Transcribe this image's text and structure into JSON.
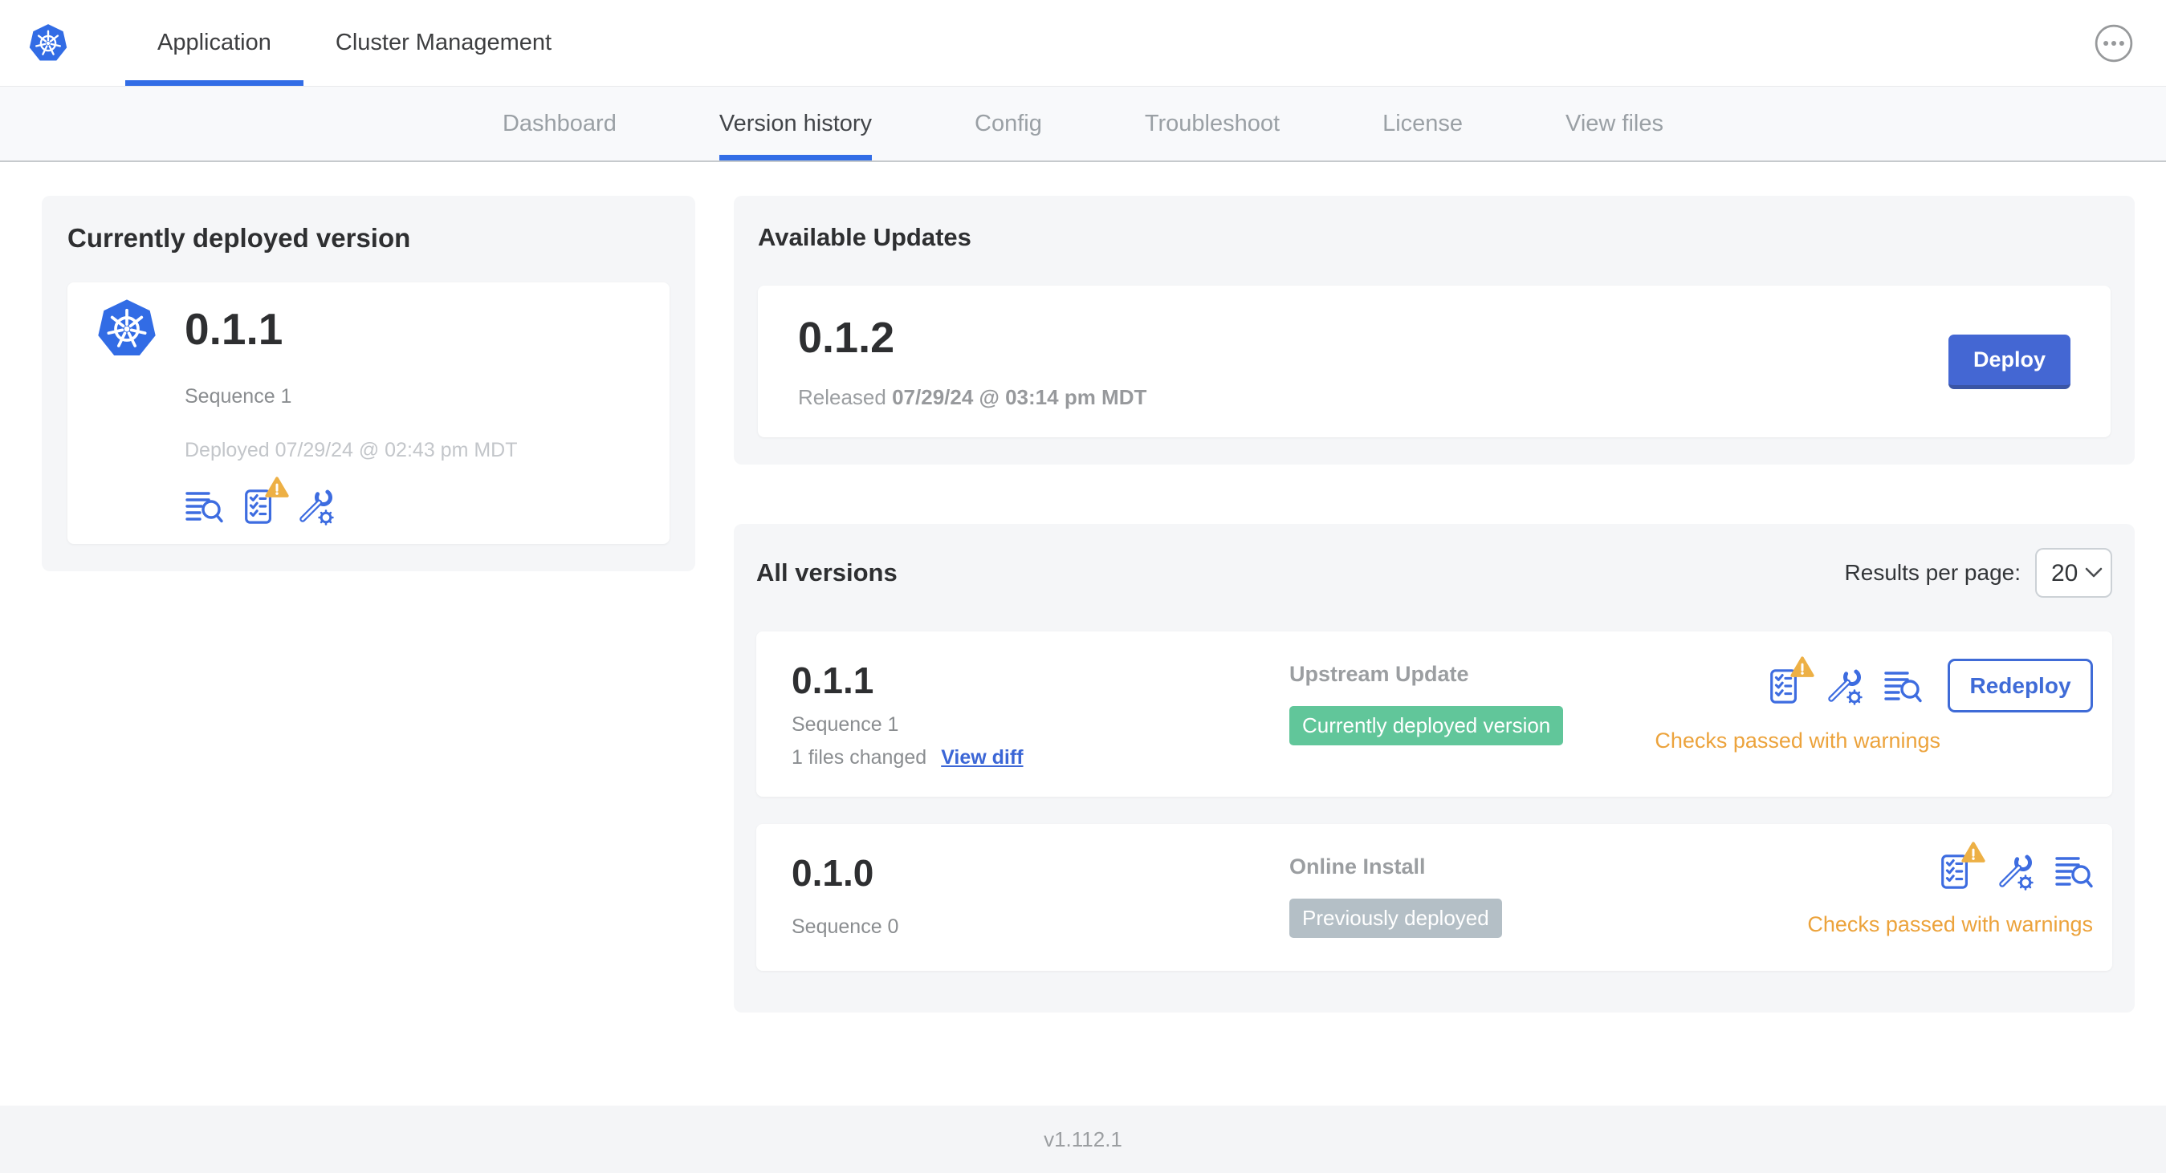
{
  "colors": {
    "brand_blue": "#326ce5",
    "accent_blue": "#3d6ce0",
    "deploy_button_blue": "#4467d3",
    "active_underline_blue": "#326de6",
    "success_green": "#61c69a",
    "muted_badge_gray": "#b4bfc6",
    "warning_orange": "#eca33c",
    "card_background": "#f5f6f8",
    "text_dark": "#323232",
    "text_gray": "#9b9ea1"
  },
  "header": {
    "logo_icon": "kubernetes-logo",
    "overflow_icon": "ellipsis-menu-icon",
    "tabs": [
      {
        "label": "Application",
        "active": true
      },
      {
        "label": "Cluster Management",
        "active": false
      }
    ]
  },
  "subnav": {
    "tabs": [
      {
        "label": "Dashboard",
        "active": false
      },
      {
        "label": "Version history",
        "active": true
      },
      {
        "label": "Config",
        "active": false
      },
      {
        "label": "Troubleshoot",
        "active": false
      },
      {
        "label": "License",
        "active": false
      },
      {
        "label": "View files",
        "active": false
      }
    ]
  },
  "current_version": {
    "title": "Currently deployed version",
    "version": "0.1.1",
    "sequence": "Sequence 1",
    "deployed": "Deployed 07/29/24 @ 02:43 pm MDT",
    "icons": [
      "logs-search-icon",
      "preflight-checks-warning-icon",
      "config-wrench-icon"
    ]
  },
  "available_updates": {
    "title": "Available Updates",
    "version": "0.1.2",
    "released_label": "Released",
    "released_date": "07/29/24 @ 03:14 pm MDT",
    "deploy_label": "Deploy"
  },
  "all_versions": {
    "title": "All versions",
    "results_per_page_label": "Results per page:",
    "results_per_page_value": "20",
    "rows": [
      {
        "version": "0.1.1",
        "sequence": "Sequence 1",
        "files_changed": "1 files changed",
        "view_diff_label": "View diff",
        "source": "Upstream Update",
        "badge_label": "Currently deployed version",
        "badge_type": "green",
        "status": "Checks passed with warnings",
        "action_label": "Redeploy",
        "icons": [
          "preflight-checks-warning-icon",
          "config-wrench-icon",
          "logs-search-icon"
        ]
      },
      {
        "version": "0.1.0",
        "sequence": "Sequence 0",
        "source": "Online Install",
        "badge_label": "Previously deployed",
        "badge_type": "gray",
        "status": "Checks passed with warnings",
        "icons": [
          "preflight-checks-warning-icon",
          "config-wrench-icon",
          "logs-search-icon"
        ]
      }
    ]
  },
  "footer": {
    "app_version": "v1.112.1"
  }
}
